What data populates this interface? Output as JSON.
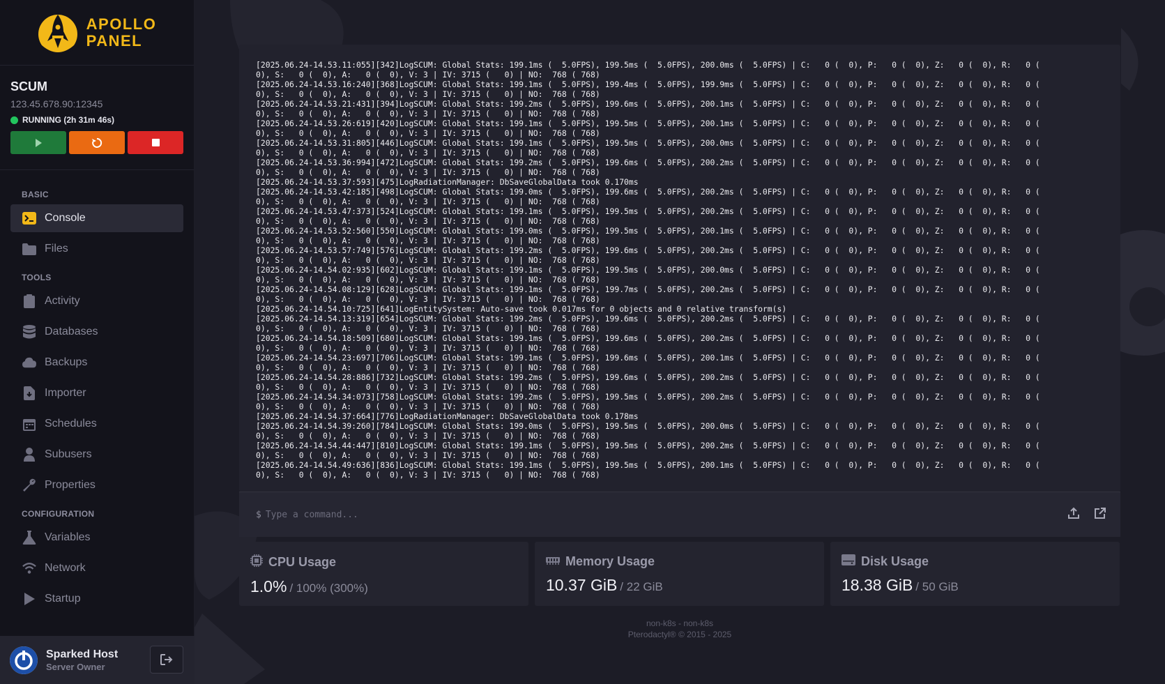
{
  "brand": {
    "line1": "APOLLO",
    "line2": "PANEL",
    "accent": "#f2b818"
  },
  "server": {
    "name": "SCUM",
    "address": "123.45.678.90:12345",
    "status": "RUNNING (2h 31m 46s)"
  },
  "nav": {
    "section_basic": "BASIC",
    "console": "Console",
    "files": "Files",
    "section_tools": "TOOLS",
    "activity": "Activity",
    "databases": "Databases",
    "backups": "Backups",
    "importer": "Importer",
    "schedules": "Schedules",
    "subusers": "Subusers",
    "properties": "Properties",
    "section_config": "CONFIGURATION",
    "variables": "Variables",
    "network": "Network",
    "startup": "Startup"
  },
  "user": {
    "name": "Sparked Host",
    "role": "Server Owner"
  },
  "console": {
    "lines": [
      "[2025.06.24-14.53.11:055][342]LogSCUM: Global Stats: 199.1ms (  5.0FPS), 199.5ms (  5.0FPS), 200.0ms (  5.0FPS) | C:   0 (  0), P:   0 (  0), Z:   0 (  0), R:   0 (",
      "0), S:   0 (  0), A:   0 (  0), V: 3 | IV: 3715 (   0) | NO:  768 ( 768)",
      "[2025.06.24-14.53.16:240][368]LogSCUM: Global Stats: 199.1ms (  5.0FPS), 199.4ms (  5.0FPS), 199.9ms (  5.0FPS) | C:   0 (  0), P:   0 (  0), Z:   0 (  0), R:   0 (",
      "0), S:   0 (  0), A:   0 (  0), V: 3 | IV: 3715 (   0) | NO:  768 ( 768)",
      "[2025.06.24-14.53.21:431][394]LogSCUM: Global Stats: 199.2ms (  5.0FPS), 199.6ms (  5.0FPS), 200.1ms (  5.0FPS) | C:   0 (  0), P:   0 (  0), Z:   0 (  0), R:   0 (",
      "0), S:   0 (  0), A:   0 (  0), V: 3 | IV: 3715 (   0) | NO:  768 ( 768)",
      "[2025.06.24-14.53.26:619][420]LogSCUM: Global Stats: 199.1ms (  5.0FPS), 199.5ms (  5.0FPS), 200.1ms (  5.0FPS) | C:   0 (  0), P:   0 (  0), Z:   0 (  0), R:   0 (",
      "0), S:   0 (  0), A:   0 (  0), V: 3 | IV: 3715 (   0) | NO:  768 ( 768)",
      "[2025.06.24-14.53.31:805][446]LogSCUM: Global Stats: 199.1ms (  5.0FPS), 199.5ms (  5.0FPS), 200.0ms (  5.0FPS) | C:   0 (  0), P:   0 (  0), Z:   0 (  0), R:   0 (",
      "0), S:   0 (  0), A:   0 (  0), V: 3 | IV: 3715 (   0) | NO:  768 ( 768)",
      "[2025.06.24-14.53.36:994][472]LogSCUM: Global Stats: 199.2ms (  5.0FPS), 199.6ms (  5.0FPS), 200.2ms (  5.0FPS) | C:   0 (  0), P:   0 (  0), Z:   0 (  0), R:   0 (",
      "0), S:   0 (  0), A:   0 (  0), V: 3 | IV: 3715 (   0) | NO:  768 ( 768)",
      "[2025.06.24-14.53.37:593][475]LogRadiationManager: DbSaveGlobalData took 0.170ms",
      "[2025.06.24-14.53.42:185][498]LogSCUM: Global Stats: 199.0ms (  5.0FPS), 199.6ms (  5.0FPS), 200.2ms (  5.0FPS) | C:   0 (  0), P:   0 (  0), Z:   0 (  0), R:   0 (",
      "0), S:   0 (  0), A:   0 (  0), V: 3 | IV: 3715 (   0) | NO:  768 ( 768)",
      "[2025.06.24-14.53.47:373][524]LogSCUM: Global Stats: 199.1ms (  5.0FPS), 199.5ms (  5.0FPS), 200.2ms (  5.0FPS) | C:   0 (  0), P:   0 (  0), Z:   0 (  0), R:   0 (",
      "0), S:   0 (  0), A:   0 (  0), V: 3 | IV: 3715 (   0) | NO:  768 ( 768)",
      "[2025.06.24-14.53.52:560][550]LogSCUM: Global Stats: 199.0ms (  5.0FPS), 199.5ms (  5.0FPS), 200.1ms (  5.0FPS) | C:   0 (  0), P:   0 (  0), Z:   0 (  0), R:   0 (",
      "0), S:   0 (  0), A:   0 (  0), V: 3 | IV: 3715 (   0) | NO:  768 ( 768)",
      "[2025.06.24-14.53.57:749][576]LogSCUM: Global Stats: 199.2ms (  5.0FPS), 199.6ms (  5.0FPS), 200.2ms (  5.0FPS) | C:   0 (  0), P:   0 (  0), Z:   0 (  0), R:   0 (",
      "0), S:   0 (  0), A:   0 (  0), V: 3 | IV: 3715 (   0) | NO:  768 ( 768)",
      "[2025.06.24-14.54.02:935][602]LogSCUM: Global Stats: 199.1ms (  5.0FPS), 199.5ms (  5.0FPS), 200.0ms (  5.0FPS) | C:   0 (  0), P:   0 (  0), Z:   0 (  0), R:   0 (",
      "0), S:   0 (  0), A:   0 (  0), V: 3 | IV: 3715 (   0) | NO:  768 ( 768)",
      "[2025.06.24-14.54.08:129][628]LogSCUM: Global Stats: 199.1ms (  5.0FPS), 199.7ms (  5.0FPS), 200.2ms (  5.0FPS) | C:   0 (  0), P:   0 (  0), Z:   0 (  0), R:   0 (",
      "0), S:   0 (  0), A:   0 (  0), V: 3 | IV: 3715 (   0) | NO:  768 ( 768)",
      "[2025.06.24-14.54.10:725][641]LogEntitySystem: Auto-save took 0.017ms for 0 objects and 0 relative transform(s)",
      "[2025.06.24-14.54.13:319][654]LogSCUM: Global Stats: 199.2ms (  5.0FPS), 199.6ms (  5.0FPS), 200.2ms (  5.0FPS) | C:   0 (  0), P:   0 (  0), Z:   0 (  0), R:   0 (",
      "0), S:   0 (  0), A:   0 (  0), V: 3 | IV: 3715 (   0) | NO:  768 ( 768)",
      "[2025.06.24-14.54.18:509][680]LogSCUM: Global Stats: 199.1ms (  5.0FPS), 199.6ms (  5.0FPS), 200.2ms (  5.0FPS) | C:   0 (  0), P:   0 (  0), Z:   0 (  0), R:   0 (",
      "0), S:   0 (  0), A:   0 (  0), V: 3 | IV: 3715 (   0) | NO:  768 ( 768)",
      "[2025.06.24-14.54.23:697][706]LogSCUM: Global Stats: 199.1ms (  5.0FPS), 199.6ms (  5.0FPS), 200.1ms (  5.0FPS) | C:   0 (  0), P:   0 (  0), Z:   0 (  0), R:   0 (",
      "0), S:   0 (  0), A:   0 (  0), V: 3 | IV: 3715 (   0) | NO:  768 ( 768)",
      "[2025.06.24-14.54.28:886][732]LogSCUM: Global Stats: 199.2ms (  5.0FPS), 199.6ms (  5.0FPS), 200.2ms (  5.0FPS) | C:   0 (  0), P:   0 (  0), Z:   0 (  0), R:   0 (",
      "0), S:   0 (  0), A:   0 (  0), V: 3 | IV: 3715 (   0) | NO:  768 ( 768)",
      "[2025.06.24-14.54.34:073][758]LogSCUM: Global Stats: 199.2ms (  5.0FPS), 199.5ms (  5.0FPS), 200.2ms (  5.0FPS) | C:   0 (  0), P:   0 (  0), Z:   0 (  0), R:   0 (",
      "0), S:   0 (  0), A:   0 (  0), V: 3 | IV: 3715 (   0) | NO:  768 ( 768)",
      "[2025.06.24-14.54.37:664][776]LogRadiationManager: DbSaveGlobalData took 0.178ms",
      "[2025.06.24-14.54.39:260][784]LogSCUM: Global Stats: 199.0ms (  5.0FPS), 199.5ms (  5.0FPS), 200.0ms (  5.0FPS) | C:   0 (  0), P:   0 (  0), Z:   0 (  0), R:   0 (",
      "0), S:   0 (  0), A:   0 (  0), V: 3 | IV: 3715 (   0) | NO:  768 ( 768)",
      "[2025.06.24-14.54.44:447][810]LogSCUM: Global Stats: 199.1ms (  5.0FPS), 199.5ms (  5.0FPS), 200.2ms (  5.0FPS) | C:   0 (  0), P:   0 (  0), Z:   0 (  0), R:   0 (",
      "0), S:   0 (  0), A:   0 (  0), V: 3 | IV: 3715 (   0) | NO:  768 ( 768)",
      "[2025.06.24-14.54.49:636][836]LogSCUM: Global Stats: 199.1ms (  5.0FPS), 199.5ms (  5.0FPS), 200.1ms (  5.0FPS) | C:   0 (  0), P:   0 (  0), Z:   0 (  0), R:   0 (",
      "0), S:   0 (  0), A:   0 (  0), V: 3 | IV: 3715 (   0) | NO:  768 ( 768)"
    ],
    "prompt": "$",
    "placeholder": "Type a command..."
  },
  "stats": {
    "cpu": {
      "label": "CPU Usage",
      "value": "1.0%",
      "limit": "/ 100% (300%)"
    },
    "memory": {
      "label": "Memory Usage",
      "value": "10.37 GiB",
      "limit": "/ 22 GiB"
    },
    "disk": {
      "label": "Disk Usage",
      "value": "18.38 GiB",
      "limit": "/ 50 GiB"
    }
  },
  "footer": {
    "line1": "non-k8s - non-k8s",
    "line2": "Pterodactyl® © 2015 - 2025"
  },
  "icons": {
    "start": "play-icon",
    "restart": "restart-icon",
    "stop": "stop-icon",
    "console": "terminal-icon",
    "files": "folder-icon",
    "activity": "clipboard-icon",
    "databases": "database-icon",
    "backups": "cloud-icon",
    "importer": "file-import-icon",
    "schedules": "calendar-icon",
    "subusers": "user-icon",
    "properties": "wrench-icon",
    "variables": "flask-icon",
    "network": "wifi-icon",
    "startup": "play-icon",
    "logout": "logout-icon",
    "upload": "upload-icon",
    "external": "external-link-icon",
    "cpu": "chip-icon",
    "memory": "memory-icon",
    "disk": "hdd-icon"
  }
}
